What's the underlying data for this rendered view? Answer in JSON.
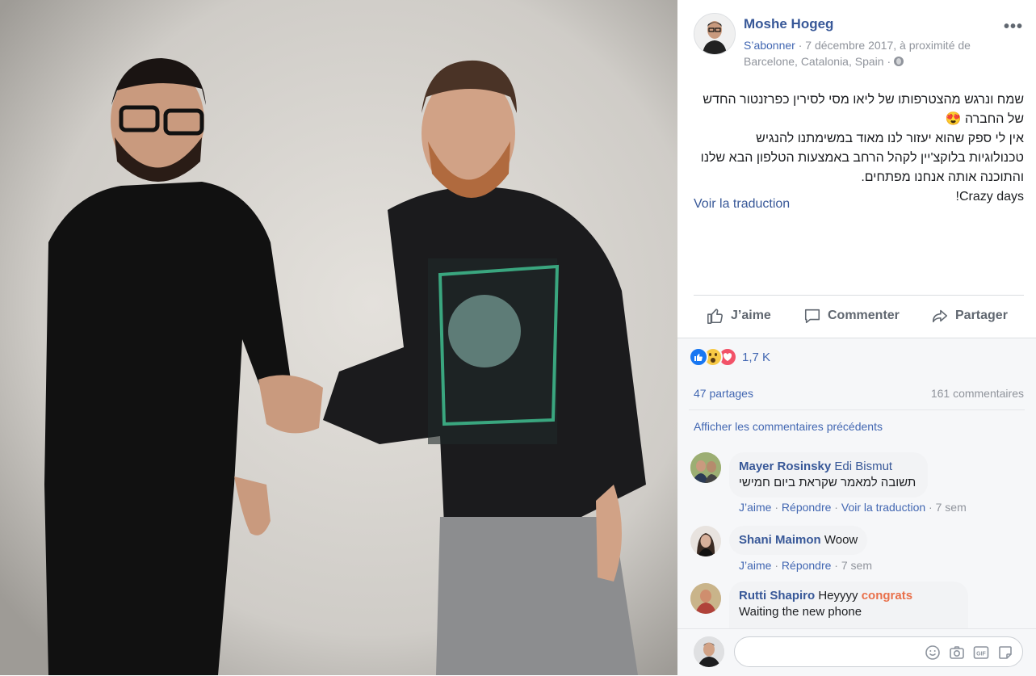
{
  "post": {
    "author": "Moshe Hogeg",
    "subscribe": "S’abonner",
    "date_location_line1": "· 7 décembre 2017, à proximité de",
    "date_location_line2": "Barcelone, Catalonia, Spain ·",
    "text_lines": [
      "שמח ונרגש מהצטרפותו של ליאו מסי לסירין כפרזנטור החדש",
      "של החברה 😍",
      "אין לי ספק שהוא יעזור לנו מאוד במשימתנו להנגיש",
      "טכנולוגיות בלוקצ'יין לקהל הרחב באמצעות הטלפון הבא שלנו",
      "והתוכנה אותה אנחנו מפתחים.",
      "Crazy days!"
    ],
    "see_translation": "Voir la traduction"
  },
  "actions": {
    "like": "J’aime",
    "comment": "Commenter",
    "share": "Partager"
  },
  "stats": {
    "reactions_count": "1,7 K",
    "shares": "47 partages",
    "comments": "161 commentaires"
  },
  "show_previous": "Afficher les commentaires précédents",
  "comments": [
    {
      "author": "Mayer Rosinsky",
      "mention": "Edi Bismut",
      "text": "תשובה למאמר שקראת ביום חמישי",
      "like": "J’aime",
      "reply": "Répondre",
      "translate": "Voir la traduction",
      "time": "7 sem"
    },
    {
      "author": "Shani Maimon",
      "text": "Woow",
      "like": "J’aime",
      "reply": "Répondre",
      "time": "7 sem"
    },
    {
      "author": "Rutti Shapiro",
      "text": "Heyyyy",
      "highlight": "congrats",
      "line2": "Waiting the new phone"
    }
  ],
  "colors": {
    "link": "#385898",
    "action_link": "#4267b2",
    "grey": "#90949c",
    "highlight": "#e9704a",
    "love": "#f25268",
    "like": "#1877f2"
  },
  "icons": [
    "globe-icon",
    "like-outline-icon",
    "comment-outline-icon",
    "share-outline-icon",
    "like-reaction-icon",
    "wow-reaction-icon",
    "love-reaction-icon",
    "emoji-icon",
    "camera-icon",
    "gif-icon",
    "sticker-icon",
    "more-options-icon"
  ]
}
